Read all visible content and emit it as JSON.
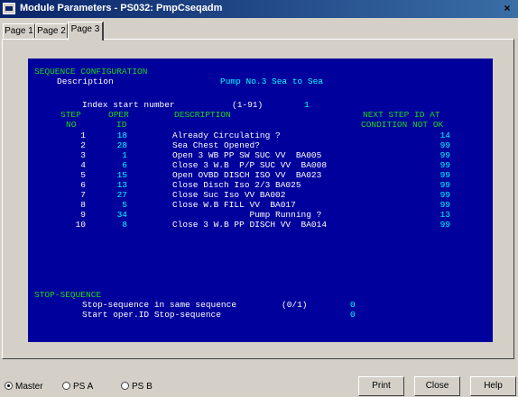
{
  "window": {
    "title": "Module Parameters - PS032: PmpCseqadm",
    "close_glyph": "×"
  },
  "tabs": [
    {
      "label": "Page 1"
    },
    {
      "label": "Page 2"
    },
    {
      "label": "Page 3",
      "active": true
    }
  ],
  "screen": {
    "section_title": "SEQUENCE CONFIGURATION",
    "description_label": "Description",
    "description_value": "Pump No.3 Sea to Sea",
    "index_label": "Index start number",
    "index_range": "(1-91)",
    "index_value": "1",
    "headers": {
      "step": "STEP",
      "no": "NO",
      "oper": "OPER",
      "id": "ID",
      "description": "DESCRIPTION",
      "next_step": "NEXT STEP ID AT",
      "condition": "CONDITION NOT OK"
    },
    "rows": [
      {
        "no": "1",
        "oper": "18",
        "desc": "Already Circulating ?",
        "next": "14"
      },
      {
        "no": "2",
        "oper": "28",
        "desc": "Sea Chest Opened?",
        "next": "99"
      },
      {
        "no": "3",
        "oper": "1",
        "desc": "Open 3 WB PP SW SUC VV  BA005",
        "next": "99"
      },
      {
        "no": "4",
        "oper": "6",
        "desc": "Close 3 W.B  P/P SUC VV  BA008",
        "next": "99"
      },
      {
        "no": "5",
        "oper": "15",
        "desc": "Open OVBD DISCH ISO VV  BA023",
        "next": "99"
      },
      {
        "no": "6",
        "oper": "13",
        "desc": "Close Disch Iso 2/3 BA025",
        "next": "99"
      },
      {
        "no": "7",
        "oper": "27",
        "desc": "Close Suc Iso VV BA002",
        "next": "99"
      },
      {
        "no": "8",
        "oper": "5",
        "desc": "Close W.B FILL VV  BA017",
        "next": "99"
      },
      {
        "no": "9",
        "oper": "34",
        "desc": "               Pump Running ?",
        "next": "13"
      },
      {
        "no": "10",
        "oper": "8",
        "desc": "Close 3 W.B PP DISCH VV  BA014",
        "next": "99"
      }
    ],
    "stop_title": "STOP-SEQUENCE",
    "stop_same_label": "Stop-sequence in same sequence",
    "stop_same_range": "(0/1)",
    "stop_same_value": "0",
    "stop_start_label": "Start oper.ID Stop-sequence",
    "stop_start_value": "0"
  },
  "bottom": {
    "radios": [
      {
        "label": "Master",
        "checked": true
      },
      {
        "label": "PS A",
        "checked": false
      },
      {
        "label": "PS B",
        "checked": false
      }
    ],
    "buttons": {
      "print": "Print",
      "close": "Close",
      "help": "Help"
    }
  }
}
